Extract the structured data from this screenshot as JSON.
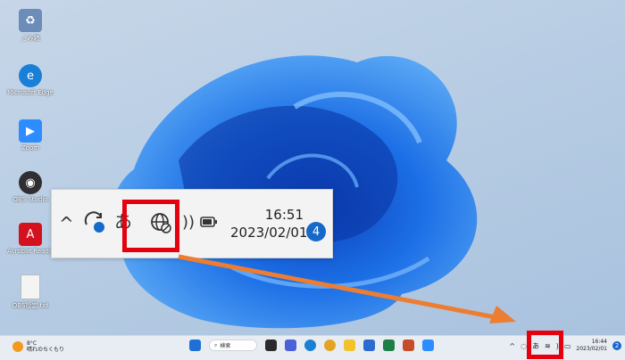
{
  "desktop": {
    "icons": [
      {
        "label": "ごみ箱",
        "icon": "recycle-bin-icon",
        "color": "#6b8db8"
      },
      {
        "label": "Microsoft Edge",
        "icon": "edge-icon",
        "color": "#1a7fd6"
      },
      {
        "label": "Zoom",
        "icon": "zoom-icon",
        "color": "#2d8cff"
      },
      {
        "label": "OBS Studio",
        "icon": "obs-icon",
        "color": "#302e31"
      },
      {
        "label": "Acrobat Reader",
        "icon": "acrobat-icon",
        "color": "#d4111e"
      },
      {
        "label": "OBS設定.txt",
        "icon": "text-file-icon",
        "color": "#f4f4f4"
      }
    ]
  },
  "zoom_callout": {
    "time": "16:51",
    "date": "2023/02/01",
    "notification_count": "4",
    "ime_label": "あ",
    "caret": "^"
  },
  "taskbar": {
    "weather_temp": "8°C",
    "weather_desc": "晴れのちくもり",
    "search_label": "検索",
    "tray_ime": "あ",
    "time": "16:44",
    "date": "2023/02/01",
    "notification_count": "2"
  },
  "colors": {
    "highlight": "#e5000f",
    "arrow": "#ed7d31",
    "accent": "#1668c9"
  }
}
